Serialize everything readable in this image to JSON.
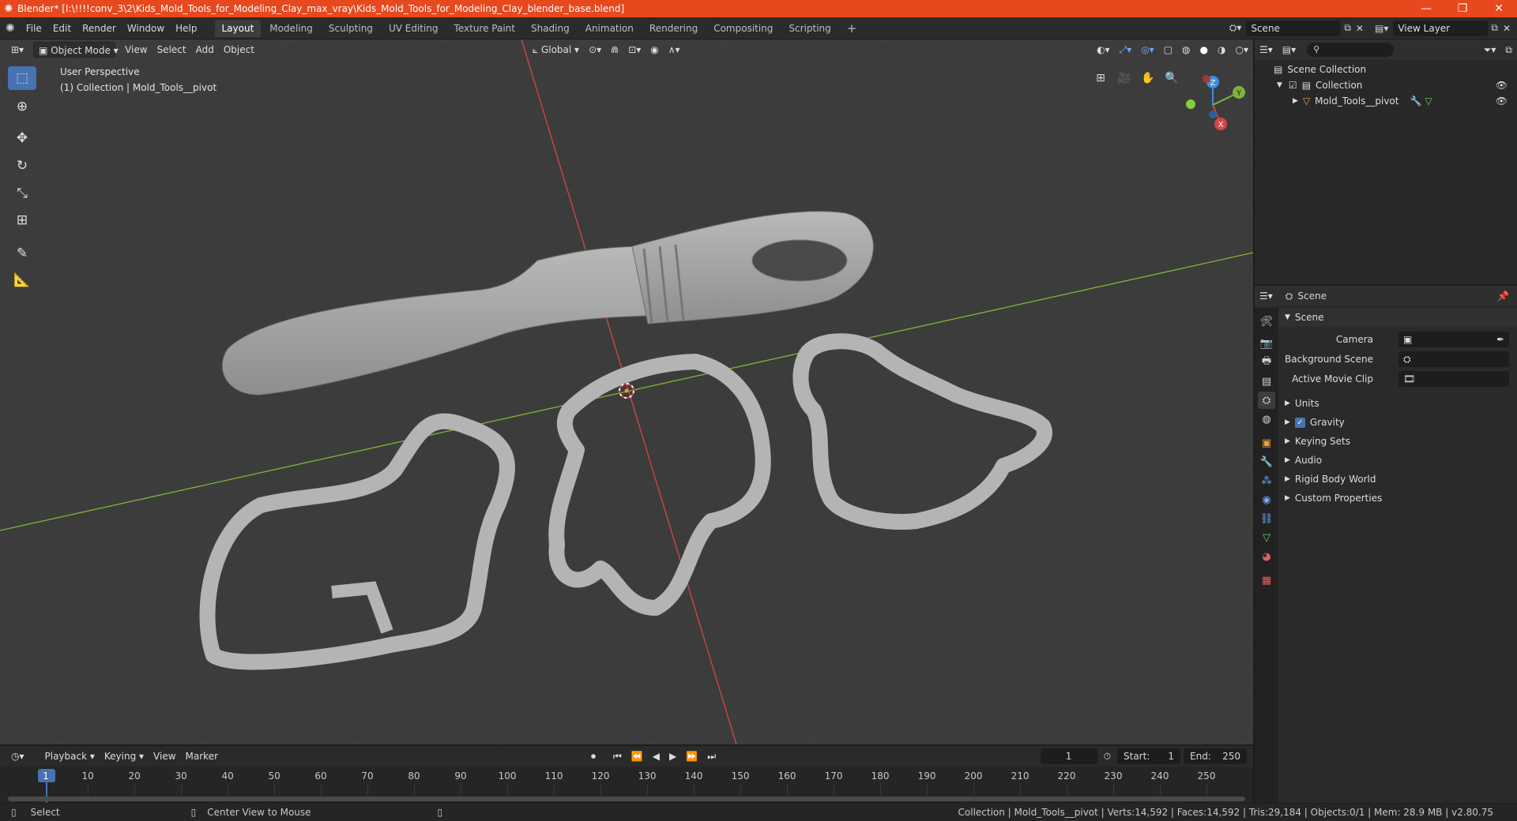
{
  "window": {
    "title": "Blender* [I:\\!!!!conv_3\\2\\Kids_Mold_Tools_for_Modeling_Clay_max_vray\\Kids_Mold_Tools_for_Modeling_Clay_blender_base.blend]",
    "minimize": "—",
    "maximize": "❐",
    "close": "✕"
  },
  "menu": [
    "File",
    "Edit",
    "Render",
    "Window",
    "Help"
  ],
  "workspaces": [
    "Layout",
    "Modeling",
    "Sculpting",
    "UV Editing",
    "Texture Paint",
    "Shading",
    "Animation",
    "Rendering",
    "Compositing",
    "Scripting"
  ],
  "workspace_add": "+",
  "scene_name": "Scene",
  "view_layer": "View Layer",
  "viewport": {
    "mode": "Object Mode",
    "menus": [
      "View",
      "Select",
      "Add",
      "Object"
    ],
    "transform_orientation": "Global",
    "info_line1": "User Perspective",
    "info_line2": "(1) Collection | Mold_Tools__pivot",
    "gizmo": {
      "x": "X",
      "y": "Y",
      "z": "Z"
    }
  },
  "outliner": {
    "root": "Scene Collection",
    "collection": "Collection",
    "object": "Mold_Tools__pivot"
  },
  "properties": {
    "header": "Scene",
    "panel": "Scene",
    "camera_label": "Camera",
    "background_scene_label": "Background Scene",
    "active_movie_clip_label": "Active Movie Clip",
    "sections": [
      "Units",
      "Gravity",
      "Keying Sets",
      "Audio",
      "Rigid Body World",
      "Custom Properties"
    ]
  },
  "timeline": {
    "menus": [
      "Playback",
      "Keying",
      "View",
      "Marker"
    ],
    "current_frame": "1",
    "start_label": "Start:",
    "start": "1",
    "end_label": "End:",
    "end": "250",
    "ruler": [
      "1",
      "10",
      "20",
      "30",
      "40",
      "50",
      "60",
      "70",
      "80",
      "90",
      "100",
      "110",
      "120",
      "130",
      "140",
      "150",
      "160",
      "170",
      "180",
      "190",
      "200",
      "210",
      "220",
      "230",
      "240",
      "250"
    ]
  },
  "status": {
    "left_action": "Select",
    "middle_action": "Center View to Mouse",
    "right": "Collection | Mold_Tools__pivot | Verts:14,592 | Faces:14,592 | Tris:29,184 | Objects:0/1 | Mem: 28.9 MB | v2.80.75"
  },
  "colors": {
    "title_bar": "#e8481e",
    "active_tool": "#4772b3",
    "x_axis": "#d64545",
    "y_axis": "#7eb43a",
    "z_axis": "#3b8ede"
  }
}
